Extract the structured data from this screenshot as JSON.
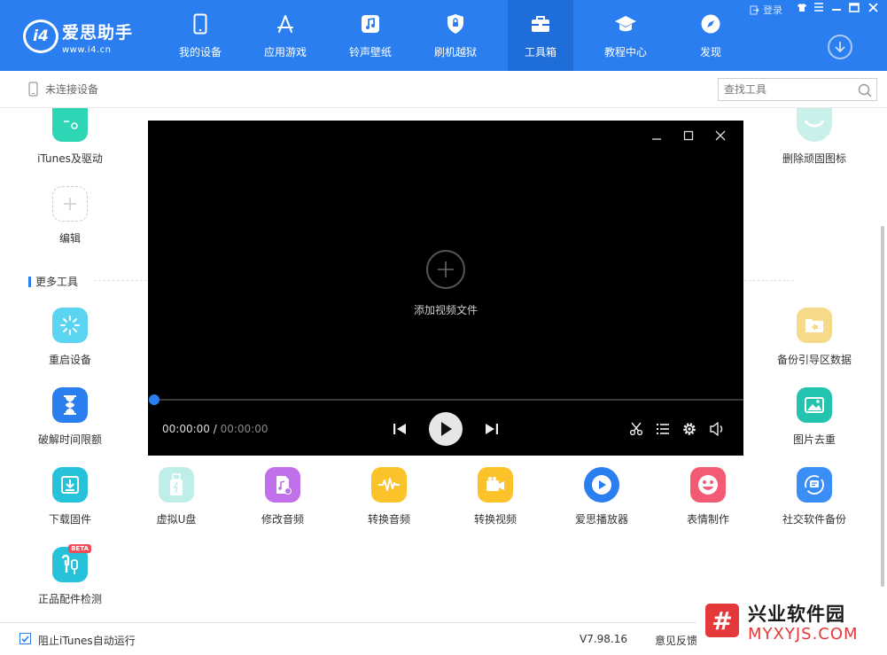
{
  "brand": {
    "name": "爱思助手",
    "url": "www.i4.cn",
    "logo_text": "i4"
  },
  "nav": [
    {
      "label": "我的设备",
      "icon": "phone-icon"
    },
    {
      "label": "应用游戏",
      "icon": "appstore-icon"
    },
    {
      "label": "铃声壁纸",
      "icon": "music-icon"
    },
    {
      "label": "刷机越狱",
      "icon": "shield-icon"
    },
    {
      "label": "工具箱",
      "icon": "toolbox-icon",
      "active": true
    },
    {
      "label": "教程中心",
      "icon": "graduation-cap-icon"
    },
    {
      "label": "发现",
      "icon": "compass-icon"
    }
  ],
  "window": {
    "login_label": "登录"
  },
  "device_status": "未连接设备",
  "search": {
    "placeholder": "查找工具"
  },
  "tools_top": [
    {
      "label": "iTunes及驱动"
    },
    {
      "label": "删除顽固图标"
    },
    {
      "label": "编辑"
    }
  ],
  "section_title": "更多工具",
  "tools_more": [
    {
      "label": "重启设备"
    },
    {
      "label": "备份引导区数据"
    },
    {
      "label": "破解时间限额"
    },
    {
      "label": "图片去重"
    },
    {
      "label": "下载固件"
    },
    {
      "label": "虚拟U盘"
    },
    {
      "label": "修改音频"
    },
    {
      "label": "转换音频"
    },
    {
      "label": "转换视频"
    },
    {
      "label": "爱思播放器"
    },
    {
      "label": "表情制作"
    },
    {
      "label": "社交软件备份"
    },
    {
      "label": "正品配件检测",
      "badge": "BETA"
    }
  ],
  "player": {
    "add_label": "添加视频文件",
    "current_time": "00:00:00",
    "separator": "/",
    "duration": "00:00:00",
    "progress": 0
  },
  "footer": {
    "checkbox_label": "阻止iTunes自动运行",
    "checked": true,
    "version": "V7.98.16",
    "feedback": "意见反馈"
  },
  "watermark": {
    "symbol": "#",
    "title": "兴业软件园",
    "site": "MYXYJS.COM"
  },
  "colors": {
    "primary": "#2a7ef0",
    "active_nav": "#1f6dd9",
    "player_bg": "#000000",
    "watermark_red": "#e5383b"
  }
}
